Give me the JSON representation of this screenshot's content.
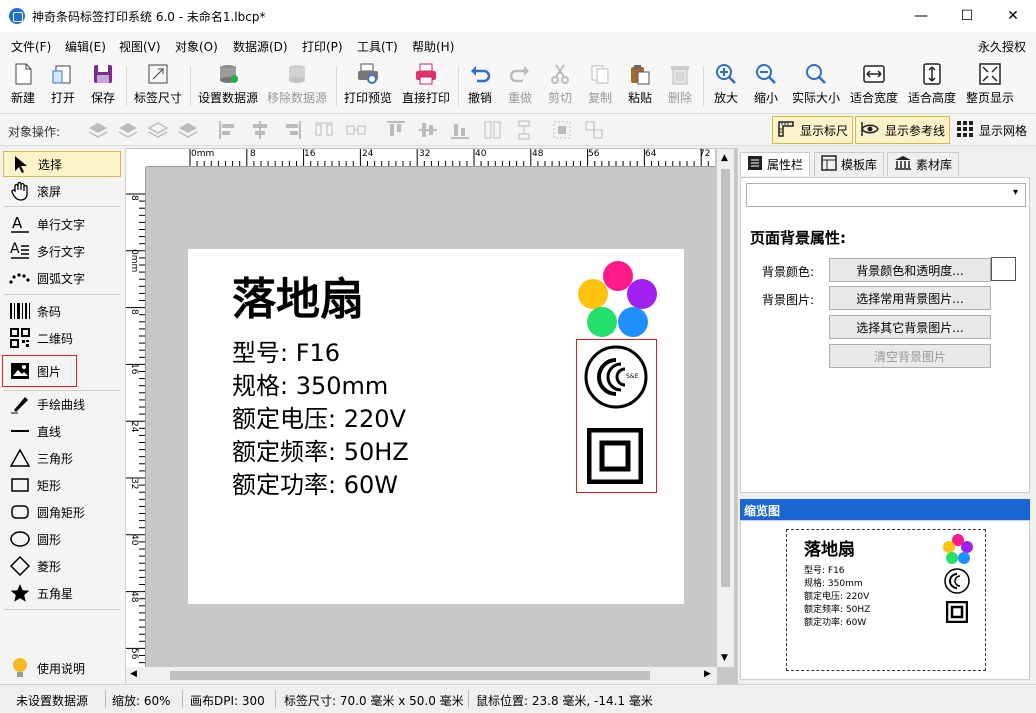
{
  "window": {
    "title": "神奇条码标签打印系统 6.0 - 未命名1.lbcp*",
    "minimize": "—",
    "maximize": "☐",
    "close": "✕"
  },
  "menubar": {
    "items": [
      "文件(F)",
      "编辑(E)",
      "视图(V)",
      "对象(O)",
      "数据源(D)",
      "打印(P)",
      "工具(T)",
      "帮助(H)"
    ],
    "license": "永久授权"
  },
  "toolbar": {
    "items": [
      {
        "label": "新建",
        "icon": "new-file-icon",
        "enabled": true
      },
      {
        "label": "打开",
        "icon": "open-file-icon",
        "enabled": true
      },
      {
        "label": "保存",
        "icon": "save-icon",
        "enabled": true
      },
      {
        "label": "标签尺寸",
        "icon": "label-size-icon",
        "enabled": true
      },
      {
        "label": "设置数据源",
        "icon": "database-icon",
        "enabled": true
      },
      {
        "label": "移除数据源",
        "icon": "remove-database-icon",
        "enabled": false
      },
      {
        "label": "打印预览",
        "icon": "print-preview-icon",
        "enabled": true
      },
      {
        "label": "直接打印",
        "icon": "printer-icon",
        "enabled": true
      },
      {
        "label": "撤销",
        "icon": "undo-icon",
        "enabled": true
      },
      {
        "label": "重做",
        "icon": "redo-icon",
        "enabled": false
      },
      {
        "label": "剪切",
        "icon": "cut-icon",
        "enabled": false
      },
      {
        "label": "复制",
        "icon": "copy-icon",
        "enabled": false
      },
      {
        "label": "粘贴",
        "icon": "paste-icon",
        "enabled": true
      },
      {
        "label": "删除",
        "icon": "delete-icon",
        "enabled": false
      },
      {
        "label": "放大",
        "icon": "zoom-in-icon",
        "enabled": true
      },
      {
        "label": "缩小",
        "icon": "zoom-out-icon",
        "enabled": true
      },
      {
        "label": "实际大小",
        "icon": "actual-size-icon",
        "enabled": true
      },
      {
        "label": "适合宽度",
        "icon": "fit-width-icon",
        "enabled": true
      },
      {
        "label": "适合高度",
        "icon": "fit-height-icon",
        "enabled": true
      },
      {
        "label": "整页显示",
        "icon": "fit-page-icon",
        "enabled": true
      }
    ]
  },
  "object_bar": {
    "label": "对象操作:",
    "show_ruler": "显示标尺",
    "show_guides": "显示参考线",
    "show_grid": "显示网格"
  },
  "tools": [
    {
      "label": "选择",
      "icon": "arrow-pointer-icon",
      "active": true
    },
    {
      "label": "滚屏",
      "icon": "hand-icon"
    },
    {
      "label": "单行文字",
      "icon": "single-line-text-icon"
    },
    {
      "label": "多行文字",
      "icon": "multi-line-text-icon"
    },
    {
      "label": "圆弧文字",
      "icon": "arc-text-icon"
    },
    {
      "label": "条码",
      "icon": "barcode-icon"
    },
    {
      "label": "二维码",
      "icon": "qrcode-icon"
    },
    {
      "label": "图片",
      "icon": "image-icon",
      "highlighted": true
    },
    {
      "label": "手绘曲线",
      "icon": "pen-icon"
    },
    {
      "label": "直线",
      "icon": "line-icon"
    },
    {
      "label": "三角形",
      "icon": "triangle-icon"
    },
    {
      "label": "矩形",
      "icon": "rectangle-icon"
    },
    {
      "label": "圆角矩形",
      "icon": "rounded-rectangle-icon"
    },
    {
      "label": "圆形",
      "icon": "circle-icon"
    },
    {
      "label": "菱形",
      "icon": "diamond-icon"
    },
    {
      "label": "五角星",
      "icon": "star-icon"
    },
    {
      "label": "使用说明",
      "icon": "lightbulb-icon"
    }
  ],
  "rulers": {
    "top_labels": [
      "0mm",
      "8",
      "16",
      "24",
      "32",
      "40",
      "48",
      "56",
      "64",
      "72"
    ],
    "left_labels": [
      "8",
      "0mm",
      "8",
      "16",
      "24",
      "32",
      "40",
      "48",
      "56"
    ]
  },
  "label": {
    "title": "落地扇",
    "lines": [
      "型号: F16",
      "规格: 350mm",
      "额定电压: 220V",
      "额定频率: 50HZ",
      "额定功率: 60W"
    ],
    "cert_text": "S&E",
    "circle_colors": [
      "#ff1a8c",
      "#ffc20e",
      "#a020f0",
      "#22e06a",
      "#1e90ff"
    ]
  },
  "right_panel": {
    "tabs": [
      "属性栏",
      "模板库",
      "素材库"
    ],
    "dropdown_value": "",
    "section_title": "页面背景属性:",
    "bg_color_label": "背景颜色:",
    "bg_color_button": "背景颜色和透明度...",
    "bg_image_label": "背景图片:",
    "bg_common_button": "选择常用背景图片...",
    "bg_other_button": "选择其它背景图片...",
    "bg_clear_button": "清空背景图片",
    "preview_title": "缩览图"
  },
  "statusbar": {
    "datasource": "未设置数据源",
    "zoom": "缩放: 60%",
    "dpi": "画布DPI: 300",
    "size": "标签尺寸: 70.0 毫米 x 50.0 毫米",
    "mouse": "鼠标位置: 23.8 毫米, -14.1 毫米"
  },
  "colors": {
    "accent_blue": "#1a66d2",
    "highlight_red": "#e02020",
    "toggle_bg": "#fdf3c8"
  }
}
